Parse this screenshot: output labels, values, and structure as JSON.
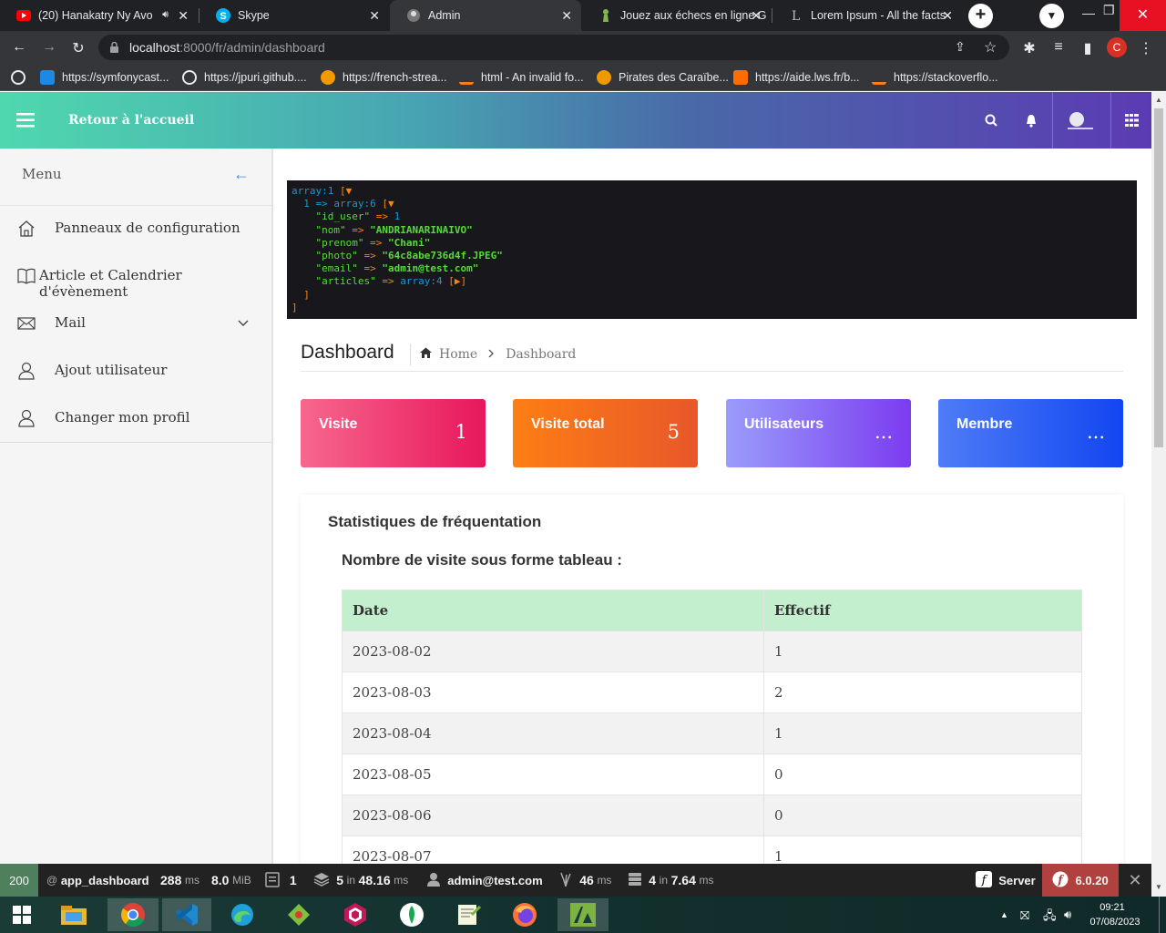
{
  "browser": {
    "tabs": [
      {
        "title": "(20) Hanakatry Ny Avo",
        "icon": "youtube-icon",
        "active": false
      },
      {
        "title": "Skype",
        "icon": "skype-icon",
        "active": false
      },
      {
        "title": "Admin",
        "icon": "admin-favicon-icon",
        "active": true
      },
      {
        "title": "Jouez aux échecs en ligne G",
        "icon": "chess-pawn-icon",
        "active": false
      },
      {
        "title": "Lorem Ipsum - All the facts",
        "icon": "lorem-ipsum-icon",
        "active": false
      }
    ],
    "url_host": "localhost",
    "url_path": ":8000/fr/admin/dashboard",
    "profile_initial": "C",
    "bookmarks": [
      {
        "label": "https://symfonycast...",
        "icon": "symfonycasts-icon"
      },
      {
        "label": "https://jpuri.github....",
        "icon": "github-icon"
      },
      {
        "label": "https://french-strea...",
        "icon": "play-icon"
      },
      {
        "label": "html - An invalid fo...",
        "icon": "stackoverflow-icon"
      },
      {
        "label": "Pirates des Caraïbe...",
        "icon": "play-icon"
      },
      {
        "label": "https://aide.lws.fr/b...",
        "icon": "lws-icon"
      },
      {
        "label": "https://stackoverflo...",
        "icon": "stackoverflow-icon"
      }
    ]
  },
  "header": {
    "brand": "Retour à l'accueil"
  },
  "sidebar": {
    "title": "Menu",
    "items": [
      {
        "label": "Panneaux de configuration",
        "icon": "home-icon"
      },
      {
        "label": "Article et Calendrier d'évènement",
        "icon": "book-icon"
      },
      {
        "label": "Mail",
        "icon": "mail-icon"
      },
      {
        "label": "Ajout utilisateur",
        "icon": "user-icon"
      },
      {
        "label": "Changer mon profil",
        "icon": "user-icon"
      }
    ]
  },
  "dump": {
    "l1": "array:1",
    "l1b": " [▼",
    "l2a": "  1 => ",
    "l2b": "array:6",
    "l2c": " [▼",
    "l3k": "    \"id_user\"",
    "l3v": "1",
    "l4k": "    \"nom\"",
    "l4v": "\"ANDRIANARINAIVO\"",
    "l5k": "    \"prenom\"",
    "l5v": "\"Chani\"",
    "l6k": "    \"photo\"",
    "l6v": "\"64c8abe736d4f.JPEG\"",
    "l7k": "    \"email\"",
    "l7v": "\"admin@test.com\"",
    "l8k": "    \"articles\"",
    "l8v": "array:4",
    "l8c": " [▶]",
    "arrow": " => ",
    "l9": "  ]",
    "l10": "]"
  },
  "page": {
    "title": "Dashboard",
    "breadcrumb_home": "Home",
    "breadcrumb_current": "Dashboard"
  },
  "cards": [
    {
      "title": "Visite",
      "value": "1",
      "color_from": "#f7678c",
      "color_to": "#e8175d"
    },
    {
      "title": "Visite total",
      "value": "5",
      "color_from": "#fd7e14",
      "color_to": "#e8572a"
    },
    {
      "title": "Utilisateurs",
      "value": "...",
      "color_from": "#9a9cfb",
      "color_to": "#7c3cf0"
    },
    {
      "title": "Membre",
      "value": "...",
      "color_from": "#4f7cf7",
      "color_to": "#1246f0"
    }
  ],
  "stats": {
    "title": "Statistiques de fréquentation",
    "subtitle": "Nombre de visite sous forme tableau :",
    "columns": [
      "Date",
      "Effectif"
    ],
    "rows": [
      [
        "2023-08-02",
        "1"
      ],
      [
        "2023-08-03",
        "2"
      ],
      [
        "2023-08-04",
        "1"
      ],
      [
        "2023-08-05",
        "0"
      ],
      [
        "2023-08-06",
        "0"
      ],
      [
        "2023-08-07",
        "1"
      ]
    ]
  },
  "symfony_toolbar": {
    "status": "200",
    "route": "app_dashboard",
    "time_value": "288",
    "time_unit": "ms",
    "memory_value": "8.0",
    "memory_unit": "MiB",
    "forms": "1",
    "cache_count": "5",
    "cache_in": "in",
    "cache_time": "48.16",
    "cache_unit": "ms",
    "user": "admin@test.com",
    "twig_value": "46",
    "twig_unit": "ms",
    "db_count": "4",
    "db_in": "in",
    "db_time": "7.64",
    "db_unit": "ms",
    "server": "Server",
    "version": "6.0.20"
  },
  "taskbar": {
    "time": "09:21",
    "date": "07/08/2023"
  }
}
